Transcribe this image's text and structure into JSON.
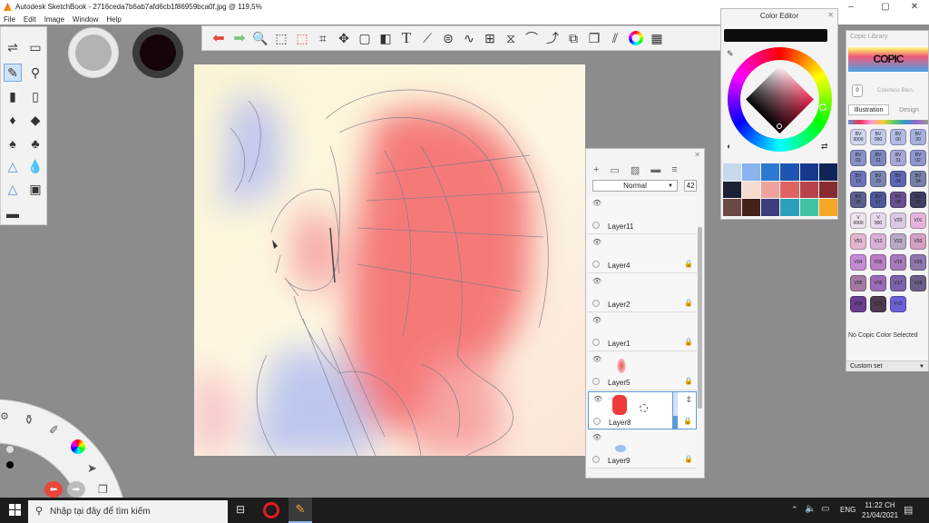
{
  "window": {
    "title": "Autodesk SketchBook - 2716ceda7b6ab7afd6cb1f86959bca0f.jpg @ 119,5%",
    "minimize_icon": "minimize-icon",
    "maximize_icon": "maximize-icon",
    "close_icon": "close-icon"
  },
  "menu": [
    "File",
    "Edit",
    "Image",
    "Window",
    "Help"
  ],
  "tool_palette": {
    "tools": [
      "brush-settings-icon",
      "brush-palette-icon",
      "pencil-icon",
      "ballpoint-icon",
      "marker-icon",
      "felt-tip-icon",
      "paint-brush-icon",
      "airbrush-icon",
      "ink-pen-icon",
      "calligraphy-icon",
      "smudge-icon",
      "drop-blur-icon",
      "triangle-tool-icon",
      "fill-icon",
      "eraser-icon"
    ]
  },
  "color_wells": {
    "primary": "#b3b3b3",
    "secondary": "#140308"
  },
  "toolbar": {
    "icons": [
      "undo-icon",
      "redo-icon",
      "zoom-icon",
      "select-icon",
      "magic-wand-select-icon",
      "crop-icon",
      "transform-icon",
      "distort-icon",
      "fill-tool-icon",
      "text-icon",
      "ruler-icon",
      "ellipse-guide-icon",
      "french-curve-icon",
      "perspective-icon",
      "symmetry-icon",
      "stroke-icon",
      "predictive-stroke-icon",
      "copy-paste-icon",
      "layer-editor-icon",
      "brush-library-icon",
      "color-wheel-icon",
      "copic-library-icon"
    ]
  },
  "layers_panel": {
    "toolbar_icons": [
      "add-layer-icon",
      "folder-icon",
      "image-import-icon",
      "merge-layer-icon",
      "layer-menu-icon"
    ],
    "blend_mode": "Normal",
    "opacity": "42",
    "layers": [
      {
        "name": "Layer11",
        "locked": false,
        "selected": false
      },
      {
        "name": "Layer4",
        "locked": true,
        "selected": false
      },
      {
        "name": "Layer2",
        "locked": true,
        "selected": false
      },
      {
        "name": "Layer1",
        "locked": true,
        "selected": false
      },
      {
        "name": "Layer5",
        "locked": true,
        "selected": false
      },
      {
        "name": "Layer8",
        "locked": true,
        "selected": true
      },
      {
        "name": "Layer9",
        "locked": true,
        "selected": false
      }
    ]
  },
  "color_editor": {
    "title": "Color Editor",
    "current_color": "#0d0d0d",
    "swatches": [
      "#c6d9ef",
      "#8bb4ee",
      "#2b7bd2",
      "#1f55b2",
      "#16398d",
      "#0f2558",
      "#1c2233",
      "#f6dcd0",
      "#f0a39c",
      "#e06363",
      "#b8434b",
      "#8a2a31",
      "#6b4a43",
      "#43221a",
      "#3d3c7c",
      "#2c9fba",
      "#40c2a5",
      "#f5a623"
    ]
  },
  "copic_library": {
    "title": "Copic Library",
    "brand": "COPIC",
    "colorless_label": "Colorless Blen.",
    "tabs": [
      "Illustration",
      "Design"
    ],
    "chips": [
      {
        "code": "BV 0000",
        "color": "#d0d6ee"
      },
      {
        "code": "BV 000",
        "color": "#c3c9e9"
      },
      {
        "code": "BV 00",
        "color": "#b4bae2"
      },
      {
        "code": "BV 20",
        "color": "#a8b0de"
      },
      {
        "code": "BV 01",
        "color": "#8891c7"
      },
      {
        "code": "BV 11",
        "color": "#7f86be"
      },
      {
        "code": "BV 31",
        "color": "#a9a7d6"
      },
      {
        "code": "BV 02",
        "color": "#8f95cf"
      },
      {
        "code": "BV 13",
        "color": "#6d75b8"
      },
      {
        "code": "BV 23",
        "color": "#7b84b3"
      },
      {
        "code": "BV 04",
        "color": "#5d66b1"
      },
      {
        "code": "BV 34",
        "color": "#7780a8"
      },
      {
        "code": "BV 25",
        "color": "#5c5f8e"
      },
      {
        "code": "BV 17",
        "color": "#4c5a9a"
      },
      {
        "code": "BV 08",
        "color": "#6b4f91"
      },
      {
        "code": "BV 29",
        "color": "#3e3f63"
      },
      {
        "code": "V 0000",
        "color": "#ede2ee"
      },
      {
        "code": "V 000",
        "color": "#e7d9ec"
      },
      {
        "code": "V20",
        "color": "#dcc8e5"
      },
      {
        "code": "V01",
        "color": "#e6b4da"
      },
      {
        "code": "V91",
        "color": "#e2b7cf"
      },
      {
        "code": "V12",
        "color": "#d8b1d8"
      },
      {
        "code": "V22",
        "color": "#b8a9c6"
      },
      {
        "code": "V93",
        "color": "#d5a0c3"
      },
      {
        "code": "V04",
        "color": "#c58ad6"
      },
      {
        "code": "V05",
        "color": "#b87ec4"
      },
      {
        "code": "V15",
        "color": "#a77abc"
      },
      {
        "code": "V25",
        "color": "#8d78ae"
      },
      {
        "code": "V95",
        "color": "#a27ba0"
      },
      {
        "code": "V06",
        "color": "#9b6bb8"
      },
      {
        "code": "V17",
        "color": "#7b64a9"
      },
      {
        "code": "V28",
        "color": "#6a5e87"
      },
      {
        "code": "V09",
        "color": "#6a3f8f"
      },
      {
        "code": "V99",
        "color": "#4d3a4f"
      },
      {
        "code": "FV2",
        "color": "#6c5fd8"
      }
    ],
    "status": "No Copic Color Selected",
    "custom_set": "Custom set"
  },
  "radial_menu": {
    "icons": [
      "flip-icon",
      "brush-tool-icon",
      "color-wheel-icon",
      "pointer-icon",
      "undo-icon",
      "redo-icon",
      "layer-icon",
      "opacity-icon",
      "black-dot-icon"
    ]
  },
  "taskbar": {
    "search_placeholder": "Nhập tại đây để tìm kiếm",
    "lang": "ENG",
    "time": "11:22 CH",
    "date": "21/04/2021"
  }
}
